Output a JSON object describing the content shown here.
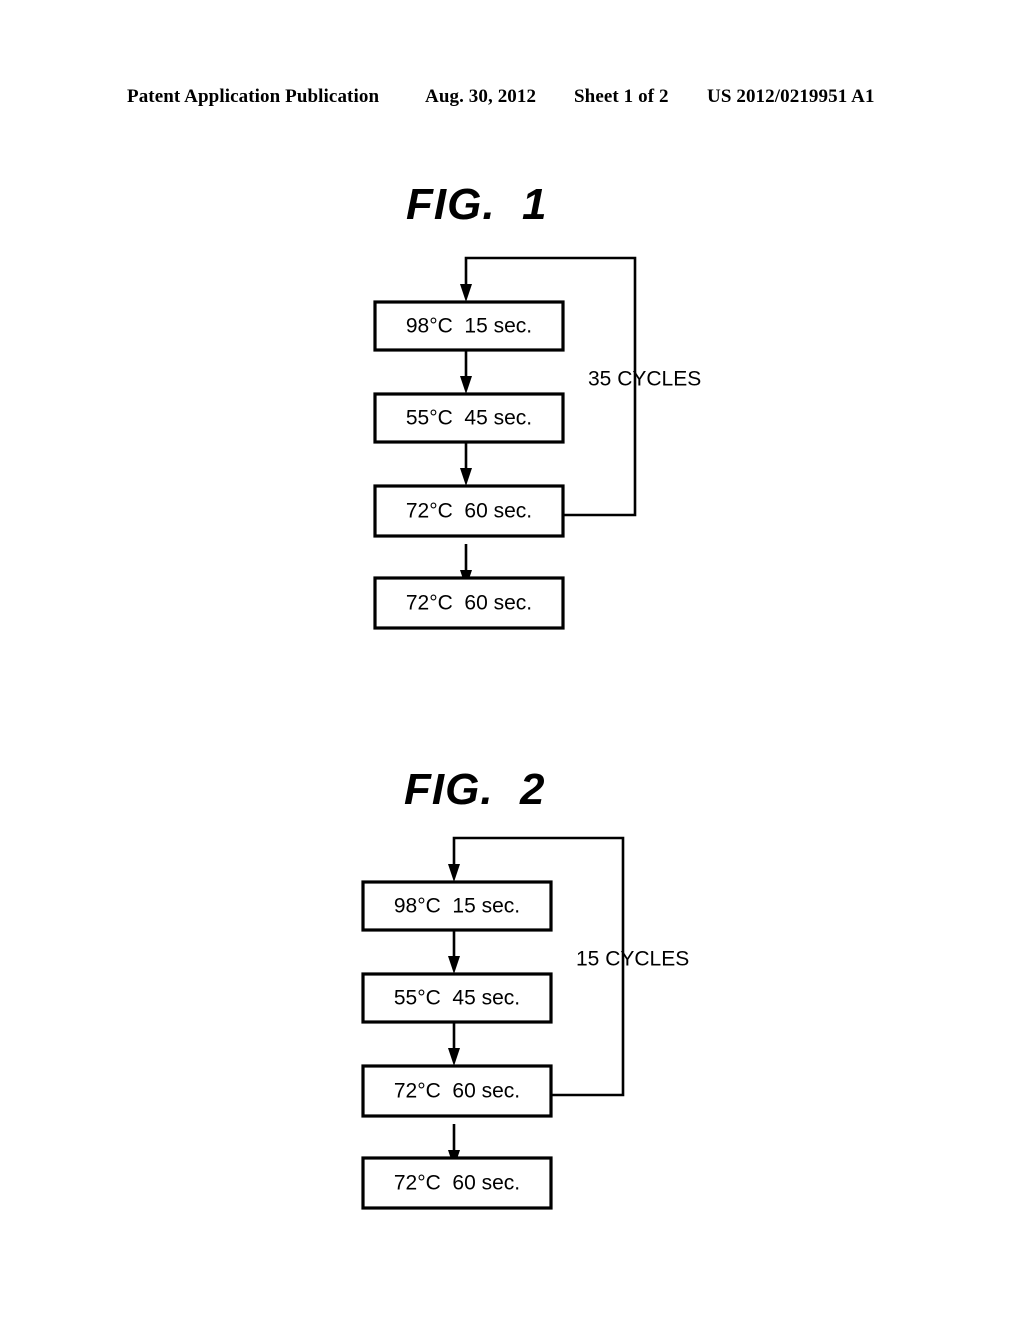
{
  "header": {
    "publication": "Patent Application Publication",
    "date": "Aug. 30, 2012",
    "sheet": "Sheet 1 of 2",
    "pub_number": "US 2012/0219951 A1"
  },
  "figures": [
    {
      "title": "FIG.  1",
      "cycles_label": "35 CYCLES",
      "steps": [
        {
          "label": "98°C  15 sec."
        },
        {
          "label": "55°C  45 sec."
        },
        {
          "label": "72°C  60 sec."
        },
        {
          "label": "72°C  60 sec."
        }
      ]
    },
    {
      "title": "FIG.  2",
      "cycles_label": "15 CYCLES",
      "steps": [
        {
          "label": "98°C  15 sec."
        },
        {
          "label": "55°C  45 sec."
        },
        {
          "label": "72°C  60 sec."
        },
        {
          "label": "72°C  60 sec."
        }
      ]
    }
  ],
  "colors": {
    "ink": "#000000",
    "paper": "#ffffff"
  }
}
